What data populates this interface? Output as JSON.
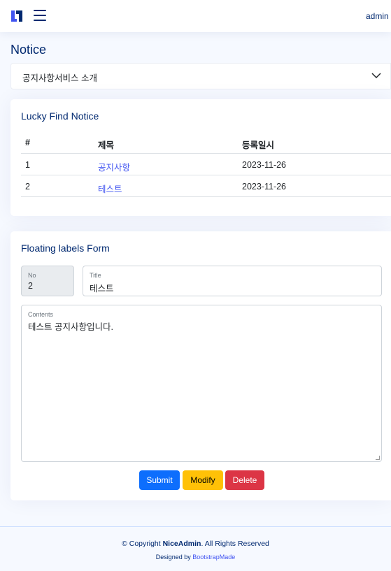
{
  "header": {
    "logo_icon": "niceadmin-logo-icon",
    "menu_icon": "hamburger-menu-icon",
    "user_name": "admin"
  },
  "page": {
    "title": "Notice"
  },
  "accordion": {
    "label": "공지사항서비스 소개",
    "chevron_icon": "chevron-down-icon"
  },
  "notice_card": {
    "title": "Lucky Find Notice",
    "columns": [
      "#",
      "제목",
      "등록일시"
    ],
    "rows": [
      {
        "num": "1",
        "title": "공지사항",
        "date": "2023-11-26"
      },
      {
        "num": "2",
        "title": "테스트",
        "date": "2023-11-26"
      }
    ]
  },
  "form_card": {
    "title": "Floating labels Form",
    "no_label": "No",
    "no_value": "2",
    "title_label": "Title",
    "title_value": "테스트",
    "contents_label": "Contents",
    "contents_value": "테스트 공지사항입니다.",
    "buttons": {
      "submit": "Submit",
      "modify": "Modify",
      "delete": "Delete"
    }
  },
  "footer": {
    "copyright_prefix": "© Copyright ",
    "brand": "NiceAdmin",
    "copyright_suffix": ". All Rights Reserved",
    "designed_by": "Designed by ",
    "designer": "BootstrapMade"
  },
  "colors": {
    "primary_text": "#012970",
    "link": "#4154f1",
    "submit": "#0d6efd",
    "modify": "#ffc107",
    "delete": "#dc3545",
    "background": "#f6f9ff"
  }
}
